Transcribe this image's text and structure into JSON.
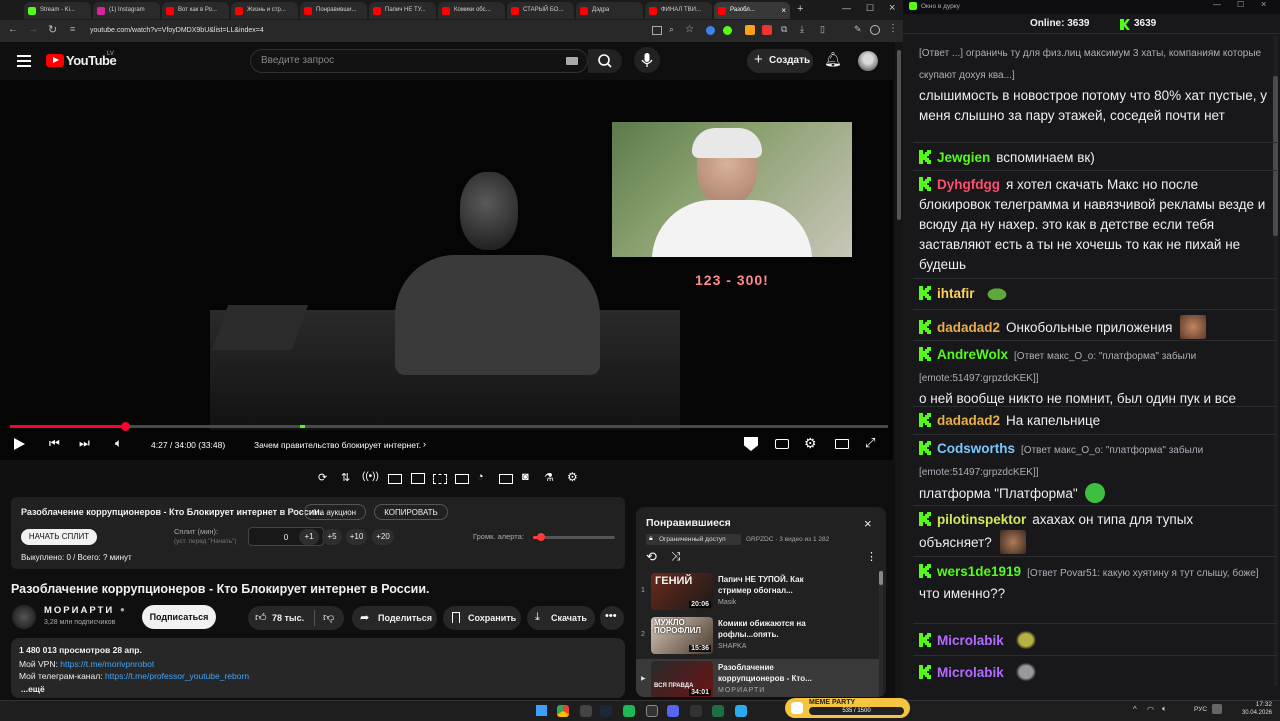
{
  "browser": {
    "tabs": [
      {
        "label": "Stream - Ki...",
        "color": "#53fc18"
      },
      {
        "label": "(1) Instagram",
        "color": "#d6249f"
      },
      {
        "label": "Вот как в Ро...",
        "color": "#ff0000"
      },
      {
        "label": "Жизнь и стр...",
        "color": "#ff0000"
      },
      {
        "label": "Понравивши...",
        "color": "#ff0000"
      },
      {
        "label": "Папич НЕ ТУ...",
        "color": "#ff0000"
      },
      {
        "label": "Комики обс...",
        "color": "#ff0000"
      },
      {
        "label": "СТАРЫЙ БО...",
        "color": "#ff0000"
      },
      {
        "label": "Дэдра",
        "color": "#ff0000"
      },
      {
        "label": "ФИНАЛ ТВИ...",
        "color": "#ff0000"
      },
      {
        "label": "Разобл... ",
        "color": "#ff0000"
      }
    ],
    "url": "youtube.com/watch?v=VfoyDMDX9bU&list=LL&index=4"
  },
  "youtube": {
    "logo_text": "YouTube",
    "logo_region": "LV",
    "search_placeholder": "Введите запрос",
    "create_label": "Создать",
    "video": {
      "overlay_text": "123 - 300!",
      "time": "4:27 / 34:00 (33:48)",
      "chapter": "Зачем правительство блокирует интернет.",
      "progress": 0.131
    },
    "ext": {
      "title": "Разоблачение коррупционеров - Кто Блокирует интернет в России.",
      "auction_btn": "На аукцион",
      "copy_btn": "КОПИРОВАТЬ",
      "start_split": "НАЧАТЬ СПЛИТ",
      "split_label": "Сплит (мин):",
      "split_hint": "(уст. перед \"Начать\")",
      "split_value": "0",
      "increments": [
        "+1",
        "+5",
        "+10",
        "+20"
      ],
      "volume_label": "Громк. алерта:",
      "volume_level": 0.1,
      "bought": "Выкуплено: 0 / Всего: ? минут"
    },
    "title": "Разоблачение коррупционеров - Кто Блокирует интернет в России.",
    "channel": {
      "name": "МОРИАРТИ",
      "subs": "3,28 млн подписчиков",
      "subscribe": "Подписаться"
    },
    "actions": {
      "likes": "78 тыс.",
      "share": "Поделиться",
      "save": "Сохранить",
      "download": "Скачать"
    },
    "description": {
      "stats": "1 480 013 просмотров  28 апр.",
      "vpn_label": "Мой VPN:",
      "vpn_link": "https://t.me/morivpnrobot",
      "tg_label": "Мой телеграм-канал:",
      "tg_link": "https://t.me/professor_youtube_reborn",
      "more": "...ещё"
    },
    "playlist": {
      "title": "Понравившиеся",
      "access": "Ограниченный доступ",
      "meta": "GRPZDC · 3 видео из 1 282",
      "items": [
        {
          "index": "1",
          "title": "Папич НЕ ТУПОЙ. Как стример обогнал...",
          "channel": "Masik",
          "duration": "20:06",
          "thumb_text": "ГЕНИЙ"
        },
        {
          "index": "2",
          "title": "Комики обижаются на рофлы...опять.",
          "channel": "SHAPKA",
          "duration": "15:36",
          "thumb_text": "МУЖЛО ПОРОФЛИЛ"
        },
        {
          "index": "▶",
          "title": "Разоблачение коррупционеров - Кто...",
          "channel": "МОРИАРТИ",
          "duration": "34:01",
          "thumb_text": "ВСЯ ПРАВДА"
        }
      ]
    }
  },
  "chat": {
    "window_title": "Окно в дурку",
    "online_label": "Online:",
    "online_count": "3639",
    "kick_count": "3639",
    "messages": [
      {
        "user": "",
        "color": "#53fc18",
        "reply": "[Ответ ...] ограничь ту для физ.лиц максимум 3 хаты, компаниям которые скупают дохуя ква...]",
        "text": "слышимость в новострое потому что 80% хат пустые, у меня слышно за пару этажей, соседей почти нет"
      },
      {
        "user": "Jewgien",
        "color": "#53fc18",
        "text": "вспоминаем вк)"
      },
      {
        "user": "Dyhgfdgg",
        "color": "#ff4d6d",
        "text": "я хотел скачать Макс но после блокировок телеграмма и навязчивой рекламы везде и всюду да ну нахер. это как в детстве если тебя заставляют есть а ты не хочешь то как не пихай не будешь"
      },
      {
        "user": "ihtafir",
        "color": "#ffd35a",
        "text": ""
      },
      {
        "user": "dadadad2",
        "color": "#e8b04a",
        "text": "Онкобольные приложения"
      },
      {
        "user": "AndreWolx",
        "color": "#53fc18",
        "reply": "[Ответ макс_О_о: \"платформа\" забыли [emote:51497:grpzdcKEK]]",
        "text": "о ней вообще никто не помнит, был один пук и все"
      },
      {
        "user": "dadadad2",
        "color": "#e8b04a",
        "text": "На капельнице"
      },
      {
        "user": "Codsworths",
        "color": "#78c8ff",
        "reply": "[Ответ макс_О_о: \"платформа\" забыли [emote:51497:grpzdcKEK]]",
        "text": "платформа \"Платформа\""
      },
      {
        "user": "pilotinspektor",
        "color": "#d6e85a",
        "text": "ахахах он типа для тупых объясняет?"
      },
      {
        "user": "wers1de1919",
        "color": "#53fc18",
        "reply": "[Ответ Povar51: какую хуятину я тут слышу, боже]",
        "text": "что именно??"
      },
      {
        "user": "Microlabik",
        "color": "#b36bff",
        "text": ""
      },
      {
        "user": "Microlabik",
        "color": "#b36bff",
        "text": ""
      }
    ]
  },
  "taskbar": {
    "lang": "РУС",
    "time": "17:32",
    "date": "30.04.2026",
    "meme_label": "MEME PARTY",
    "meme_counter": "535 / 1500"
  }
}
